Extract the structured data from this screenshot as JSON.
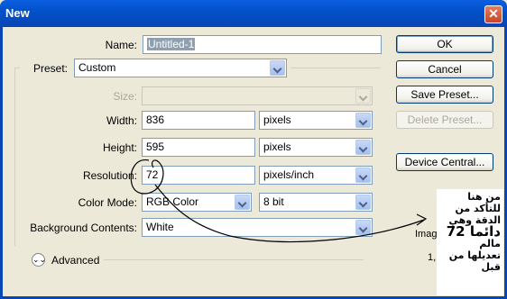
{
  "window": {
    "title": "New"
  },
  "form": {
    "name_label": "Name:",
    "name_value": "Untitled-1",
    "preset_label": "Preset:",
    "preset_value": "Custom",
    "size_label": "Size:",
    "size_value": "",
    "width_label": "Width:",
    "width_value": "836",
    "width_unit": "pixels",
    "height_label": "Height:",
    "height_value": "595",
    "height_unit": "pixels",
    "resolution_label": "Resolution:",
    "resolution_value": "72",
    "resolution_unit": "pixels/inch",
    "colormode_label": "Color Mode:",
    "colormode_value": "RGB Color",
    "bitdepth_value": "8 bit",
    "background_label": "Background Contents:",
    "background_value": "White",
    "advanced_label": "Advanced"
  },
  "buttons": {
    "ok": "OK",
    "cancel": "Cancel",
    "save_preset": "Save Preset...",
    "delete_preset": "Delete Preset...",
    "device_central": "Device Central..."
  },
  "overlay": {
    "image_label": "Image",
    "image_value": "1,"
  },
  "annotation": {
    "lines": [
      "من هنا",
      "للتأكد من",
      "الدقة وهي",
      "دائما 72",
      "مالم",
      "تعديلها من",
      "قبل"
    ]
  },
  "colors": {
    "titlebar": "#0a5fe0",
    "dialog_bg": "#ece9d8",
    "annotation_ink": "#000000"
  }
}
